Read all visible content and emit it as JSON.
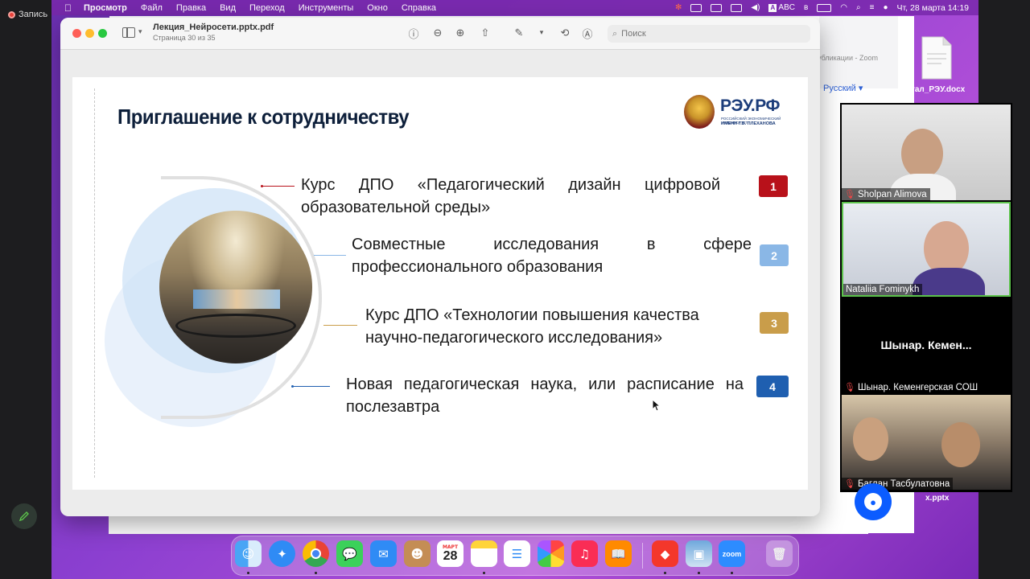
{
  "zoom": {
    "recording_label": "Запись",
    "participants": [
      {
        "name": "Sholpan Alimova"
      },
      {
        "name": "Nataliia Fominykh"
      },
      {
        "name": "Шынар.  Кеменгерская СОШ",
        "tile_label": "Шынар.  Кемен..."
      },
      {
        "name": "Баглан Тасбулатовна"
      }
    ]
  },
  "menubar": {
    "app_name": "Просмотр",
    "items": [
      "Файл",
      "Правка",
      "Вид",
      "Переход",
      "Инструменты",
      "Окно",
      "Справка"
    ],
    "input_lang": "ABC",
    "datetime": "Чт, 28 марта  14:19"
  },
  "desktop": {
    "file1": "ртал_РЭУ.docx",
    "file2": "x.pptx",
    "bg_url": "убликации - Zoom",
    "bg_lang": "Русский ▾"
  },
  "preview": {
    "doc_title": "Лекция_Нейросети.pptx.pdf",
    "page_info": "Страница 30 из 35",
    "search_placeholder": "Поиск"
  },
  "slide": {
    "title": "Приглашение к сотрудничеству",
    "logo": {
      "text": "РЭУ.РФ",
      "sub1": "РОССИЙСКИЙ ЭКОНОМИЧЕСКИЙ УНИВЕРСИТЕТ",
      "sub2": "ИМЕНИ Г.В. ПЛЕХАНОВА"
    },
    "items": [
      {
        "num": "1",
        "text": "Курс ДПО «Педагогический дизайн цифровой образовательной среды»",
        "color": "#b8111a"
      },
      {
        "num": "2",
        "text": "Совместные исследования в сфере профессионального образования",
        "color": "#8ab7e6"
      },
      {
        "num": "3",
        "text": "Курс ДПО «Технологии повышения качества научно-педагогического исследования»",
        "color": "#c99d4a"
      },
      {
        "num": "4",
        "text": "Новая педагогическая наука, или расписание на послезавтра",
        "color": "#1f5fb0"
      }
    ]
  },
  "dock": {
    "calendar_month": "МАРТ",
    "calendar_day": "28",
    "zoom_label": "zoom"
  }
}
